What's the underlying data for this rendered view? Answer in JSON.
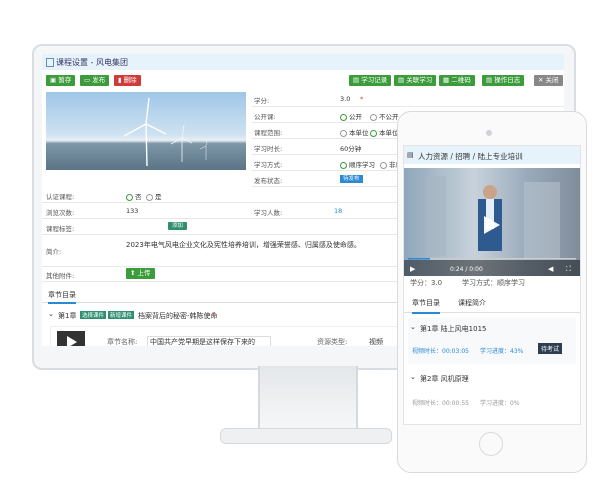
{
  "desktop": {
    "title": "课程设置 - 风电集团",
    "toolbar": {
      "save": "暂存",
      "publish": "发布",
      "delete": "删除",
      "study_record": "学习记录",
      "related": "关联学习",
      "qrcode": "二维码",
      "log": "操作日志",
      "close": "关闭"
    },
    "fields": {
      "credit_label": "学分:",
      "credit_value": "3.0",
      "public_label": "公开课:",
      "public_yes": "公开",
      "public_no": "不公开",
      "scope_label": "课程范围:",
      "scope_a": "本单位",
      "scope_b": "本单位",
      "duration_label": "学习时长:",
      "duration_value": "60分钟",
      "mode_label": "学习方式:",
      "mode_a": "顺序学习",
      "mode_b": "非顺",
      "status_label": "发布状态:",
      "status_value": "待发布",
      "cert_label": "认证课程:",
      "cert_yes": "否",
      "cert_no": "是",
      "views_label": "浏览次数:",
      "views_value": "133",
      "learners_label": "学习人数:",
      "learners_value": "18",
      "tags_label": "课程标签:",
      "tags_add": "添加",
      "intro_label": "简介:",
      "intro_value": "2023年电气风电企业文化及宪性培养培训，增强荣誉感、归属感及使命感。",
      "attach_label": "其他附件:",
      "upload": "上传"
    },
    "chapters": {
      "tab": "章节目录",
      "chapter1_num": "第1章",
      "badge1": "选择课件",
      "badge2": "新增课件",
      "chapter1_title": "档案背后的秘密-韩陈使命",
      "item_name_label": "章节名称:",
      "item_name_value": "中国共产党早期是这样保存下来的",
      "type_label": "资源类型:",
      "type_value": "视频"
    }
  },
  "mobile": {
    "title": "人力资源 / 招聘 / 陆上专业培训",
    "video_time": "0:24 / 0:00",
    "credit": "学分：3.0",
    "mode": "学习方式：顺序学习",
    "tab_chapters": "章节目录",
    "tab_intro": "课程简介",
    "ch1_title": "第1章  陆上风电1015",
    "ch1_duration": "视频时长：00:03:05",
    "ch1_progress": "学习进度：43%",
    "ch1_exam": "待考试",
    "ch2_title": "第2章  风机原理",
    "ch2_duration": "视频时长：00:00:55",
    "ch2_progress": "学习进度：0%"
  },
  "colors": {
    "green": "#3c9c3c",
    "teal": "#2f8f6f",
    "red": "#d23a3a",
    "blue": "#2b8ad1"
  }
}
